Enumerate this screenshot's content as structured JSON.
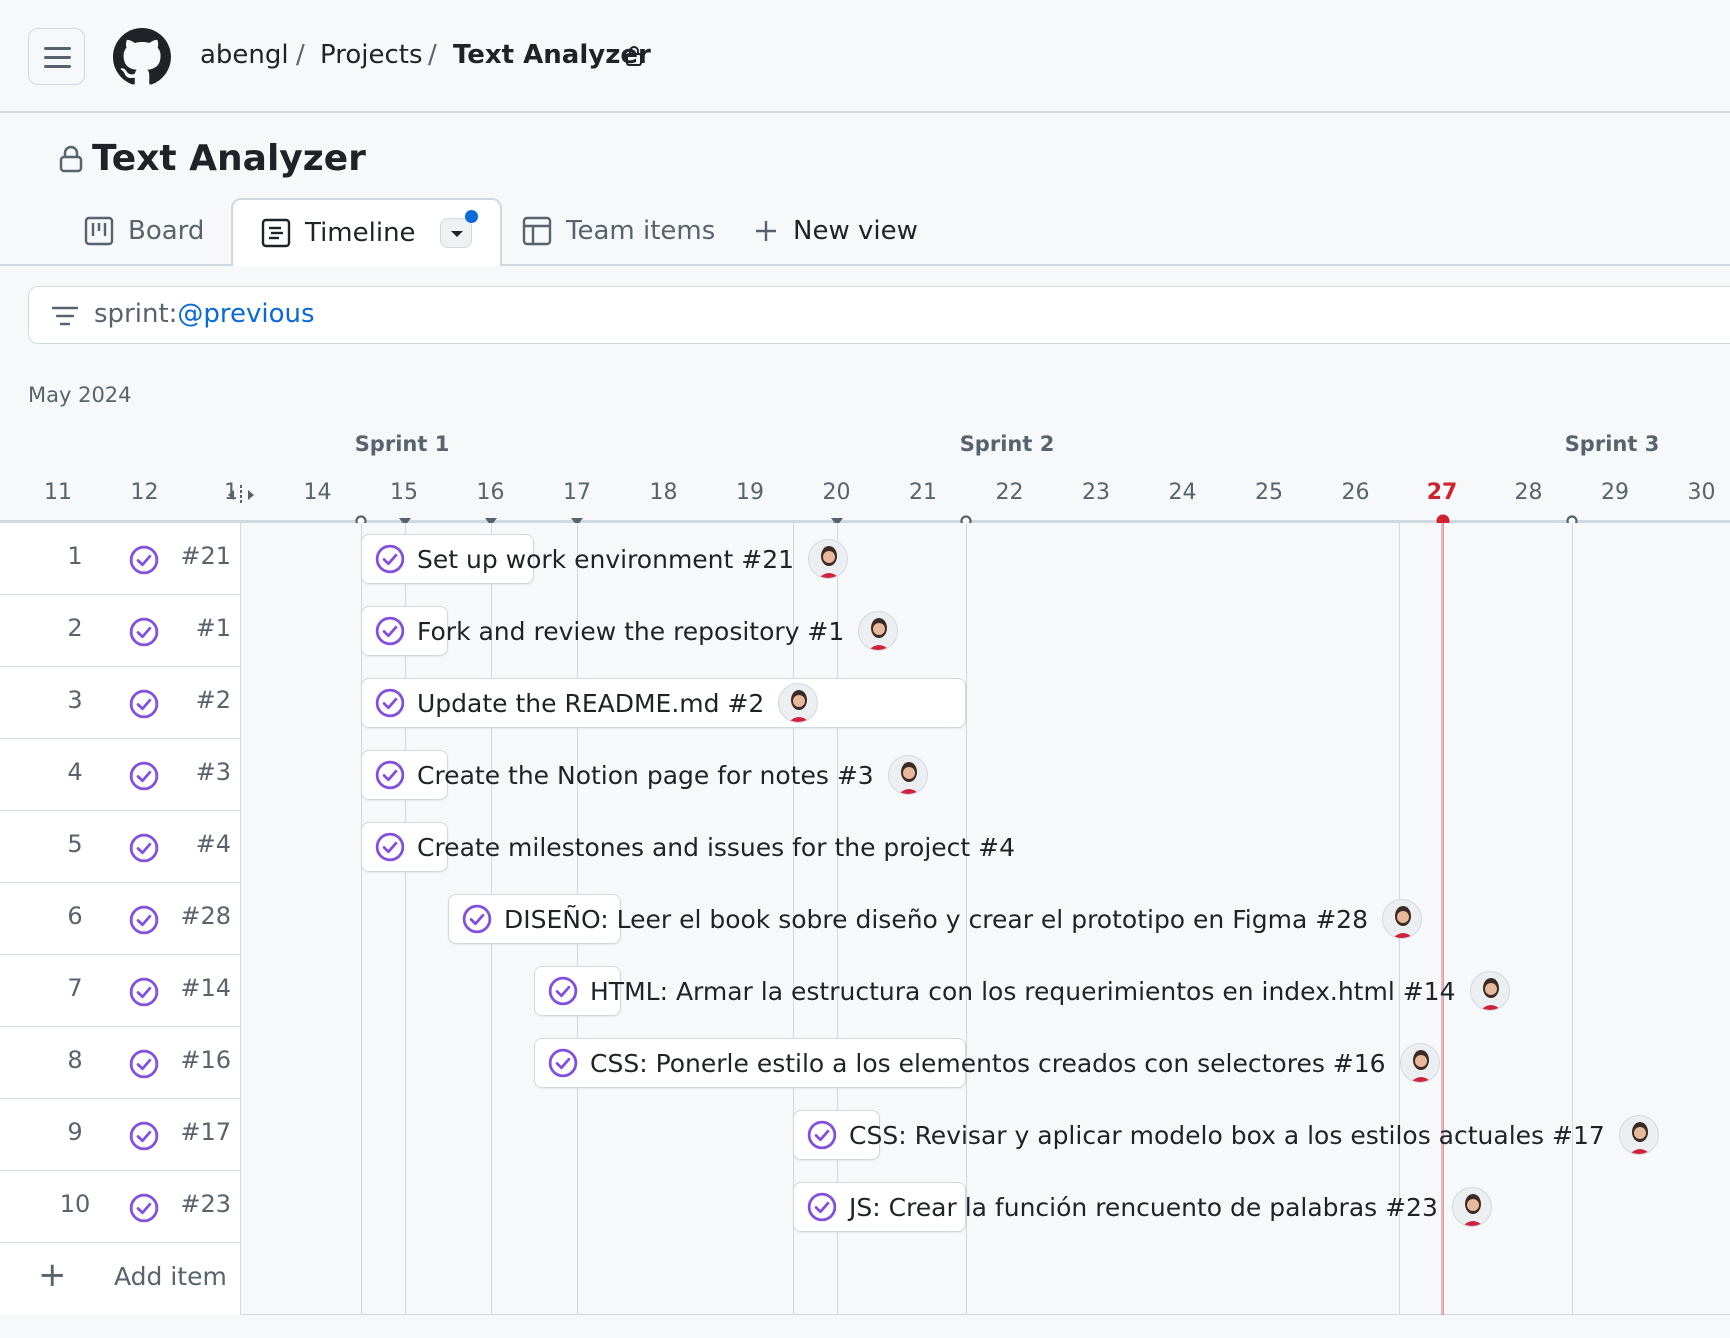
{
  "header": {
    "owner": "abengl",
    "section": "Projects",
    "project": "Text Analyzer",
    "separator": "/"
  },
  "page": {
    "title": "Text Analyzer"
  },
  "tabs": [
    {
      "label": "Board",
      "icon": "board-icon",
      "active": false
    },
    {
      "label": "Timeline",
      "icon": "timeline-icon",
      "active": true
    },
    {
      "label": "Team items",
      "icon": "table-icon",
      "active": false
    },
    {
      "label": "New view",
      "icon": "plus-icon",
      "active": false
    }
  ],
  "filter": {
    "prefix": "sprint:",
    "value": "@previous"
  },
  "timeline": {
    "month": "May 2024",
    "sprints": [
      "Sprint 1",
      "Sprint 2",
      "Sprint 3"
    ],
    "days": [
      "11",
      "12",
      "13",
      "14",
      "15",
      "16",
      "17",
      "18",
      "19",
      "20",
      "21",
      "22",
      "23",
      "24",
      "25",
      "26",
      "27",
      "28",
      "29",
      "30"
    ],
    "today": "27"
  },
  "items": [
    {
      "num": "1",
      "id": "#21",
      "title": "Set up work environment #21"
    },
    {
      "num": "2",
      "id": "#1",
      "title": "Fork and review the repository #1"
    },
    {
      "num": "3",
      "id": "#2",
      "title": "Update the README.md #2"
    },
    {
      "num": "4",
      "id": "#3",
      "title": "Create the Notion page for notes #3"
    },
    {
      "num": "5",
      "id": "#4",
      "title": "Create milestones and issues for the project #4"
    },
    {
      "num": "6",
      "id": "#28",
      "title": "DISEÑO: Leer el book sobre diseño y crear el prototipo en Figma #28"
    },
    {
      "num": "7",
      "id": "#14",
      "title": "HTML: Armar la estructura con los requerimientos en index.html #14"
    },
    {
      "num": "8",
      "id": "#16",
      "title": "CSS: Ponerle estilo a los elementos creados con selectores #16"
    },
    {
      "num": "9",
      "id": "#17",
      "title": "CSS: Revisar y aplicar modelo box a los estilos actuales #17"
    },
    {
      "num": "10",
      "id": "#23",
      "title": "JS: Crear la función rencuento de palabras #23"
    }
  ],
  "add_item_label": "Add item",
  "colors": {
    "accent": "#0969da",
    "done": "#8250df",
    "today": "#cf222e"
  }
}
